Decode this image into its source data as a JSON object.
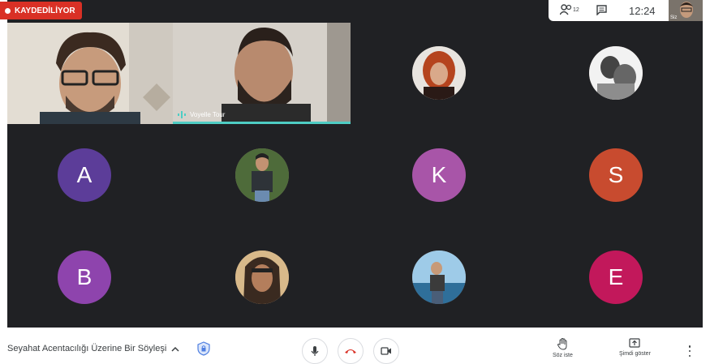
{
  "recording": {
    "label": "KAYDEDİLİYOR"
  },
  "top_bar": {
    "participant_count": "12",
    "time": "12:24",
    "self_label": "Siz"
  },
  "tiles": [
    {
      "type": "video",
      "name": ""
    },
    {
      "type": "video",
      "name": "Voyelle Tour",
      "speaking": true
    },
    {
      "type": "photo-avatar",
      "name": ""
    },
    {
      "type": "photo-avatar",
      "name": ""
    },
    {
      "type": "letter-avatar",
      "letter": "A",
      "color": "#5c3d99"
    },
    {
      "type": "photo-avatar",
      "name": ""
    },
    {
      "type": "letter-avatar",
      "letter": "K",
      "color": "#a855a8"
    },
    {
      "type": "letter-avatar",
      "letter": "S",
      "color": "#c84b2f"
    },
    {
      "type": "letter-avatar",
      "letter": "B",
      "color": "#8e44ad"
    },
    {
      "type": "photo-avatar",
      "name": ""
    },
    {
      "type": "photo-avatar",
      "name": ""
    },
    {
      "type": "letter-avatar",
      "letter": "E",
      "color": "#c2185b"
    }
  ],
  "bottom_bar": {
    "meeting_title": "Seyahat Acentacılığı Üzerine Bir Söyleşi",
    "raise_hand_label": "Söz iste",
    "present_label": "Şimdi göster"
  },
  "colors": {
    "stage_bg": "#202124",
    "recording_red": "#d93025",
    "speaking_accent": "#4ecdc4",
    "hangup_red": "#d93025"
  }
}
